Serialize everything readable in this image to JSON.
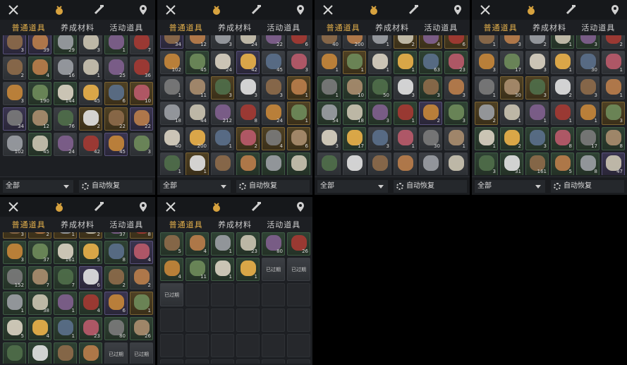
{
  "tabs": [
    "普通道具",
    "养成材料",
    "活动道具"
  ],
  "active_tab": 0,
  "filter_label": "全部",
  "auto_restore_label": "自动恢复",
  "icons": [
    "crossed-swords-icon",
    "coin-pouch-icon",
    "scroll-brush-icon",
    "location-pin-icon"
  ],
  "palette": [
    "#8c6a4a",
    "#b87d4b",
    "#9a9da3",
    "#c9c2b0",
    "#7f5f8d",
    "#a33a33",
    "#c4863a",
    "#6e8a5a",
    "#d8d0c0",
    "#e8b04a",
    "#5a6f8a",
    "#b85a6a",
    "#7a7a7a",
    "#a88c6e",
    "#4f6e4a",
    "#e0e0e0"
  ],
  "panels": [
    {
      "items": [
        {
          "r": 3,
          "c": 0,
          "q": "3"
        },
        {
          "r": 3,
          "c": 1,
          "q": "39"
        },
        {
          "r": 2,
          "c": 2,
          "q": "29"
        },
        {
          "r": 1,
          "c": 3,
          "q": "3"
        },
        {
          "r": 2,
          "c": 4,
          "q": "1"
        },
        {
          "r": 1,
          "c": 5,
          "q": "7"
        },
        {
          "r": 1,
          "c": 0,
          "q": "2"
        },
        {
          "r": 2,
          "c": 1,
          "q": "4"
        },
        {
          "r": 1,
          "c": 2,
          "q": "16"
        },
        {
          "r": 1,
          "c": 3,
          "q": "1"
        },
        {
          "r": 1,
          "c": 4,
          "q": "25"
        },
        {
          "r": 1,
          "c": 5,
          "q": "36"
        },
        {
          "r": 1,
          "c": 6,
          "q": "3"
        },
        {
          "r": 2,
          "c": 7,
          "q": "190"
        },
        {
          "r": 2,
          "c": 8,
          "q": "144"
        },
        {
          "r": 1,
          "c": 9,
          "q": "45"
        },
        {
          "r": 4,
          "c": 10,
          "q": "6"
        },
        {
          "r": 4,
          "c": 11,
          "q": "10"
        },
        {
          "r": 3,
          "c": 12,
          "q": "34"
        },
        {
          "r": 2,
          "c": 13,
          "q": "12"
        },
        {
          "r": 1,
          "c": 14,
          "q": "76"
        },
        {
          "r": 4,
          "c": 15,
          "q": "2"
        },
        {
          "r": 4,
          "c": 0,
          "q": "22"
        },
        {
          "r": 3,
          "c": 1,
          "q": "22"
        },
        {
          "r": 1,
          "c": 2,
          "q": "102"
        },
        {
          "r": 2,
          "c": 3,
          "q": "45"
        },
        {
          "r": 1,
          "c": 4,
          "q": "24"
        },
        {
          "r": 1,
          "c": 5,
          "q": "42"
        },
        {
          "r": 3,
          "c": 6,
          "q": "45"
        },
        {
          "r": 1,
          "c": 7,
          "q": "3"
        }
      ]
    },
    {
      "items": [
        {
          "r": 3,
          "c": 0,
          "q": "34"
        },
        {
          "r": 1,
          "c": 1,
          "q": "12"
        },
        {
          "r": 1,
          "c": 2,
          "q": "3"
        },
        {
          "r": 1,
          "c": 3,
          "q": "24"
        },
        {
          "r": 1,
          "c": 4,
          "q": "22"
        },
        {
          "r": 1,
          "c": 5,
          "q": "6"
        },
        {
          "r": 1,
          "c": 6,
          "q": "102"
        },
        {
          "r": 2,
          "c": 7,
          "q": "45"
        },
        {
          "r": 1,
          "c": 8,
          "q": "24"
        },
        {
          "r": 3,
          "c": 9,
          "q": "42"
        },
        {
          "r": 1,
          "c": 10,
          "q": "45"
        },
        {
          "r": 1,
          "c": 11,
          "q": "3"
        },
        {
          "r": 1,
          "c": 12,
          "q": "1"
        },
        {
          "r": 1,
          "c": 13,
          "q": "11"
        },
        {
          "r": 4,
          "c": 14,
          "q": "3"
        },
        {
          "r": 1,
          "c": 15,
          "q": "3"
        },
        {
          "r": 1,
          "c": 0,
          "q": "3"
        },
        {
          "r": 4,
          "c": 1,
          "q": "1"
        },
        {
          "r": 1,
          "c": 2,
          "q": "18"
        },
        {
          "r": 1,
          "c": 3,
          "q": "44"
        },
        {
          "r": 1,
          "c": 4,
          "q": "212"
        },
        {
          "r": 1,
          "c": 5,
          "q": "8"
        },
        {
          "r": 1,
          "c": 6,
          "q": "24"
        },
        {
          "r": 4,
          "c": 7,
          "q": "1"
        },
        {
          "r": 1,
          "c": 8,
          "q": "40"
        },
        {
          "r": 1,
          "c": 9,
          "q": "200"
        },
        {
          "r": 1,
          "c": 10,
          "q": "1"
        },
        {
          "r": 4,
          "c": 11,
          "q": "2"
        },
        {
          "r": 4,
          "c": 12,
          "q": "4"
        },
        {
          "r": 4,
          "c": 13,
          "q": "6"
        },
        {
          "r": 1,
          "c": 14,
          "q": "1"
        },
        {
          "r": 4,
          "c": 15,
          "q": "1"
        },
        {
          "r": 1,
          "c": 0,
          "q": ""
        },
        {
          "r": 2,
          "c": 1,
          "q": ""
        },
        {
          "r": 2,
          "c": 2,
          "q": ""
        },
        {
          "r": 2,
          "c": 3,
          "q": ""
        }
      ]
    },
    {
      "items": [
        {
          "r": 1,
          "c": 0,
          "q": "40"
        },
        {
          "r": 1,
          "c": 1,
          "q": "200"
        },
        {
          "r": 1,
          "c": 2,
          "q": "1"
        },
        {
          "r": 4,
          "c": 3,
          "q": "2"
        },
        {
          "r": 4,
          "c": 4,
          "q": "4"
        },
        {
          "r": 4,
          "c": 5,
          "q": "6"
        },
        {
          "r": 1,
          "c": 6,
          "q": "1"
        },
        {
          "r": 4,
          "c": 7,
          "q": "1"
        },
        {
          "r": 1,
          "c": 8,
          "q": "1"
        },
        {
          "r": 2,
          "c": 9,
          "q": "1"
        },
        {
          "r": 2,
          "c": 10,
          "q": "63"
        },
        {
          "r": 2,
          "c": 11,
          "q": "23"
        },
        {
          "r": 2,
          "c": 12,
          "q": "1"
        },
        {
          "r": 2,
          "c": 13,
          "q": "10"
        },
        {
          "r": 2,
          "c": 14,
          "q": "50"
        },
        {
          "r": 1,
          "c": 15,
          "q": "3"
        },
        {
          "r": 2,
          "c": 0,
          "q": "3"
        },
        {
          "r": 1,
          "c": 1,
          "q": "3"
        },
        {
          "r": 2,
          "c": 2,
          "q": "54"
        },
        {
          "r": 2,
          "c": 3,
          "q": "18"
        },
        {
          "r": 2,
          "c": 4,
          "q": "3"
        },
        {
          "r": 2,
          "c": 5,
          "q": "1"
        },
        {
          "r": 3,
          "c": 6,
          "q": "2"
        },
        {
          "r": 2,
          "c": 7,
          "q": "3"
        },
        {
          "r": 1,
          "c": 8,
          "q": "3"
        },
        {
          "r": 2,
          "c": 9,
          "q": "17"
        },
        {
          "r": 1,
          "c": 10,
          "q": "3"
        },
        {
          "r": 1,
          "c": 11,
          "q": "1"
        },
        {
          "r": 1,
          "c": 12,
          "q": "30"
        },
        {
          "r": 1,
          "c": 13,
          "q": "1"
        },
        {
          "r": 1,
          "c": 14,
          "q": ""
        },
        {
          "r": 1,
          "c": 15,
          "q": ""
        },
        {
          "r": 1,
          "c": 0,
          "q": ""
        },
        {
          "r": 1,
          "c": 1,
          "q": ""
        },
        {
          "r": 1,
          "c": 2,
          "q": ""
        },
        {
          "r": 1,
          "c": 3,
          "q": ""
        }
      ]
    },
    {
      "items": [
        {
          "r": 1,
          "c": 0,
          "q": "1"
        },
        {
          "r": 1,
          "c": 1,
          "q": "3"
        },
        {
          "r": 1,
          "c": 2,
          "q": "2"
        },
        {
          "r": 2,
          "c": 3,
          "q": "1"
        },
        {
          "r": 2,
          "c": 4,
          "q": "3"
        },
        {
          "r": 1,
          "c": 5,
          "q": "2"
        },
        {
          "r": 1,
          "c": 6,
          "q": "3"
        },
        {
          "r": 1,
          "c": 7,
          "q": "17"
        },
        {
          "r": 1,
          "c": 8,
          "q": "3"
        },
        {
          "r": 1,
          "c": 9,
          "q": "1"
        },
        {
          "r": 1,
          "c": 10,
          "q": "30"
        },
        {
          "r": 1,
          "c": 11,
          "q": "1"
        },
        {
          "r": 1,
          "c": 12,
          "q": "1"
        },
        {
          "r": 4,
          "c": 13,
          "q": "30"
        },
        {
          "r": 4,
          "c": 14,
          "q": "3"
        },
        {
          "r": 1,
          "c": 15,
          "q": "2"
        },
        {
          "r": 1,
          "c": 0,
          "q": "3"
        },
        {
          "r": 1,
          "c": 1,
          "q": "1"
        },
        {
          "r": 4,
          "c": 2,
          "q": "2"
        },
        {
          "r": 1,
          "c": 3,
          "q": "1"
        },
        {
          "r": 1,
          "c": 4,
          "q": "1"
        },
        {
          "r": 1,
          "c": 5,
          "q": "1"
        },
        {
          "r": 1,
          "c": 6,
          "q": "1"
        },
        {
          "r": 4,
          "c": 7,
          "q": "3"
        },
        {
          "r": 2,
          "c": 8,
          "q": "1"
        },
        {
          "r": 2,
          "c": 9,
          "q": "2"
        },
        {
          "r": 2,
          "c": 10,
          "q": "3"
        },
        {
          "r": 2,
          "c": 11,
          "q": "8"
        },
        {
          "r": 2,
          "c": 12,
          "q": "17"
        },
        {
          "r": 2,
          "c": 13,
          "q": "8"
        },
        {
          "r": 2,
          "c": 14,
          "q": "3"
        },
        {
          "r": 2,
          "c": 15,
          "q": "31"
        },
        {
          "r": 2,
          "c": 0,
          "q": "161"
        },
        {
          "r": 2,
          "c": 1,
          "q": "5"
        },
        {
          "r": 2,
          "c": 2,
          "q": "8"
        },
        {
          "r": 3,
          "c": 3,
          "q": "47"
        }
      ]
    },
    {
      "items": [
        {
          "r": 4,
          "c": 0,
          "q": "3"
        },
        {
          "r": 4,
          "c": 1,
          "q": "2"
        },
        {
          "r": 4,
          "c": 2,
          "q": "1"
        },
        {
          "r": 4,
          "c": 3,
          "q": "2"
        },
        {
          "r": 2,
          "c": 4,
          "q": "37"
        },
        {
          "r": 4,
          "c": 5,
          "q": "8"
        },
        {
          "r": 2,
          "c": 6,
          "q": "3"
        },
        {
          "r": 2,
          "c": 7,
          "q": "37"
        },
        {
          "r": 2,
          "c": 8,
          "q": "161"
        },
        {
          "r": 2,
          "c": 9,
          "q": "5"
        },
        {
          "r": 2,
          "c": 10,
          "q": "8"
        },
        {
          "r": 3,
          "c": 11,
          "q": "4"
        },
        {
          "r": 2,
          "c": 12,
          "q": "152"
        },
        {
          "r": 2,
          "c": 13,
          "q": "7"
        },
        {
          "r": 2,
          "c": 14,
          "q": "7"
        },
        {
          "r": 3,
          "c": 15,
          "q": "6"
        },
        {
          "r": 2,
          "c": 0,
          "q": "2"
        },
        {
          "r": 1,
          "c": 1,
          "q": "2"
        },
        {
          "r": 2,
          "c": 2,
          "q": "1"
        },
        {
          "r": 2,
          "c": 3,
          "q": "38"
        },
        {
          "r": 2,
          "c": 4,
          "q": "1"
        },
        {
          "r": 2,
          "c": 5,
          "q": "4"
        },
        {
          "r": 3,
          "c": 6,
          "q": "6"
        },
        {
          "r": 4,
          "c": 7,
          "q": "1"
        },
        {
          "r": 2,
          "c": 8,
          "q": "5"
        },
        {
          "r": 2,
          "c": 9,
          "q": "4"
        },
        {
          "r": 2,
          "c": 10,
          "q": "1"
        },
        {
          "r": 2,
          "c": 11,
          "q": "23"
        },
        {
          "r": 2,
          "c": 12,
          "q": "80"
        },
        {
          "r": 2,
          "c": 13,
          "q": "26"
        },
        {
          "r": 2,
          "c": 14,
          "q": ""
        },
        {
          "r": 2,
          "c": 15,
          "q": ""
        },
        {
          "r": 2,
          "c": 0,
          "q": ""
        },
        {
          "r": 2,
          "c": 1,
          "q": ""
        },
        {
          "r": 1,
          "c": 2,
          "t": "已过期"
        },
        {
          "r": 1,
          "c": 3,
          "t": "已过期"
        }
      ]
    },
    {
      "items": [
        {
          "r": 2,
          "c": 0,
          "q": "5"
        },
        {
          "r": 2,
          "c": 1,
          "q": "4"
        },
        {
          "r": 2,
          "c": 2,
          "q": "1"
        },
        {
          "r": 2,
          "c": 3,
          "q": "23"
        },
        {
          "r": 2,
          "c": 4,
          "q": "80"
        },
        {
          "r": 2,
          "c": 5,
          "q": "26"
        },
        {
          "r": 2,
          "c": 6,
          "q": "4"
        },
        {
          "r": 2,
          "c": 7,
          "q": "11"
        },
        {
          "r": 2,
          "c": 8,
          "q": "1"
        },
        {
          "r": 2,
          "c": 9,
          "q": "1"
        },
        {
          "r": 1,
          "c": 10,
          "t": "已过期"
        },
        {
          "r": 1,
          "c": 11,
          "t": "已过期"
        },
        {
          "r": 1,
          "c": 12,
          "t": "已过期"
        },
        {
          "r": 0
        },
        {
          "r": 0
        },
        {
          "r": 0
        },
        {
          "r": 0
        },
        {
          "r": 0
        },
        {
          "r": 0
        },
        {
          "r": 0
        },
        {
          "r": 0
        },
        {
          "r": 0
        },
        {
          "r": 0
        },
        {
          "r": 0
        },
        {
          "r": 0
        },
        {
          "r": 0
        },
        {
          "r": 0
        },
        {
          "r": 0
        },
        {
          "r": 0
        },
        {
          "r": 0
        },
        {
          "r": 0
        },
        {
          "r": 0
        },
        {
          "r": 0
        },
        {
          "r": 0
        },
        {
          "r": 0
        },
        {
          "r": 0
        }
      ]
    }
  ]
}
